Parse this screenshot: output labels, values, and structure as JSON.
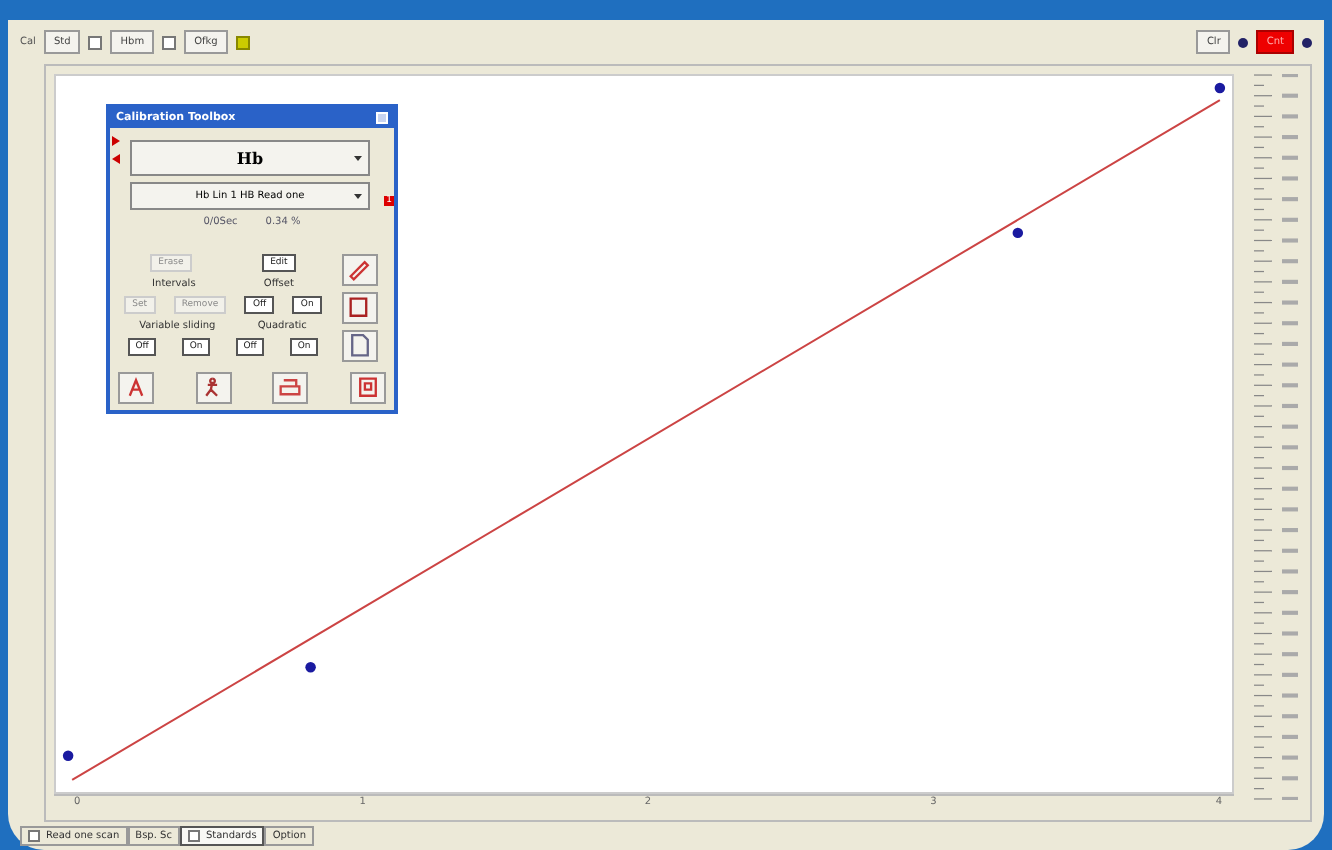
{
  "toolbar": {
    "label": "Cal",
    "items": [
      {
        "label": "Std",
        "checked": false
      },
      {
        "label": "Hbm",
        "checked": false
      },
      {
        "label": "Ofkg",
        "checked": true
      }
    ],
    "right": [
      {
        "label": "Clr",
        "kind": "plain"
      },
      {
        "label": "Cnt",
        "kind": "alert"
      }
    ]
  },
  "plot": {
    "x_labels": [
      "0",
      "1",
      "2",
      "3",
      "4"
    ]
  },
  "toolbox": {
    "title": "Calibration Toolbox",
    "analyte": "Hb",
    "method": "Hb Lin 1 HB Read one",
    "badge": "1",
    "readings": [
      "0/0Sec",
      "0.34 %"
    ],
    "actions": [
      {
        "label": "Erase",
        "disabled": true
      },
      {
        "label": "Edit",
        "disabled": false
      }
    ],
    "groups": [
      {
        "labels": [
          "Intervals",
          "Offset"
        ],
        "buttons": [
          {
            "label": "Set",
            "disabled": true
          },
          {
            "label": "Remove",
            "disabled": true
          },
          {
            "label": "Off",
            "disabled": false
          },
          {
            "label": "On",
            "disabled": false
          }
        ]
      },
      {
        "labels": [
          "Variable sliding",
          "Quadratic"
        ],
        "buttons": [
          {
            "label": "Off",
            "disabled": false
          },
          {
            "label": "On",
            "disabled": false
          },
          {
            "label": "Off",
            "disabled": false
          },
          {
            "label": "On",
            "disabled": false
          }
        ]
      }
    ]
  },
  "tabs": [
    {
      "label": "Read one scan",
      "selected": false,
      "kind": "check"
    },
    {
      "label": "Bsp. Sc",
      "selected": false,
      "kind": "plain"
    },
    {
      "label": "Standards",
      "selected": true,
      "kind": "check"
    },
    {
      "label": "Option",
      "selected": false,
      "kind": "plain"
    }
  ]
}
